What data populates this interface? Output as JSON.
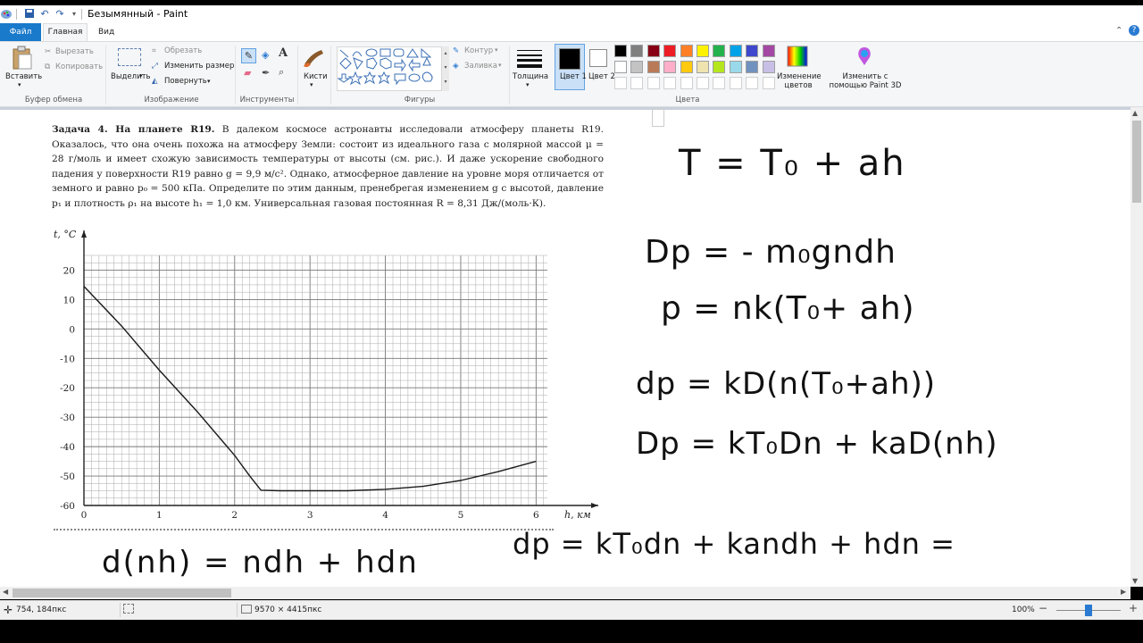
{
  "window": {
    "title": "Безымянный - Paint"
  },
  "tabs": [
    {
      "label": "Файл",
      "active": false,
      "accent": "#1979ca"
    },
    {
      "label": "Главная",
      "active": true
    },
    {
      "label": "Вид",
      "active": false
    }
  ],
  "ribbon": {
    "clipboard": {
      "paste": "Вставить",
      "cut": "Вырезать",
      "copy": "Копировать",
      "group": "Буфер обмена"
    },
    "image": {
      "select": "Выделить",
      "crop": "Обрезать",
      "resize": "Изменить размер",
      "rotate": "Повернуть",
      "group": "Изображение"
    },
    "tools": {
      "group": "Инструменты"
    },
    "brushes": {
      "label": "Кисти"
    },
    "shapes": {
      "outline": "Контур",
      "fill": "Заливка",
      "group": "Фигуры"
    },
    "size": {
      "label": "Толщина"
    },
    "colors": {
      "color1": "Цвет 1",
      "color2": "Цвет 2",
      "edit": "Изменение цветов",
      "paint3d": "Изменить с помощью Paint 3D",
      "group": "Цвета",
      "color1_value": "#000000",
      "color2_value": "#ffffff",
      "palette_row1": [
        "#000000",
        "#7f7f7f",
        "#880015",
        "#ed1c24",
        "#ff7f27",
        "#fff200",
        "#22b14c",
        "#00a2e8",
        "#3f48cc",
        "#a349a4"
      ],
      "palette_row2": [
        "#ffffff",
        "#c3c3c3",
        "#b97a57",
        "#ffaec9",
        "#ffc90e",
        "#efe4b0",
        "#b5e61d",
        "#99d9ea",
        "#7092be",
        "#c8bfe7"
      ]
    }
  },
  "problem": {
    "title": "Задача 4. На планете R19.",
    "body": " В далеком космосе астронавты исследовали атмосферу планеты R19. Оказалось, что она очень похожа на атмосферу Земли: состоит из идеального газа с молярной массой μ = 28 г/моль и имеет схожую зависимость температуры от высоты (см. рис.). И даже ускорение свободного падения у поверхности R19 равно g = 9,9 м/с². Однако, атмосферное давление на уровне моря отличается от земного и равно p₀ = 500 кПа. Определите по этим данным, пренебрегая изменением g с высотой, давление p₁ и плотность ρ₁ на высоте h₁ = 1,0 км. Универсальная газовая постоянная R = 8,31 Дж/(моль·К)."
  },
  "chart_data": {
    "type": "line",
    "xlabel": "h, км",
    "ylabel": "t, °C",
    "xlim": [
      0,
      6.15
    ],
    "ylim": [
      -60,
      25
    ],
    "x_ticks": [
      "0",
      "1",
      "2",
      "3",
      "4",
      "5",
      "6"
    ],
    "y_ticks": [
      "20",
      "10",
      "0",
      "-10",
      "-20",
      "-30",
      "-40",
      "-50",
      "-60"
    ],
    "grid": true,
    "series": [
      {
        "x": [
          0,
          0.5,
          1.0,
          1.5,
          2.0,
          2.2,
          2.35,
          2.6,
          3.0,
          3.5,
          4.0,
          4.5,
          5.0,
          5.5,
          6.0
        ],
        "y": [
          14.5,
          1,
          -14,
          -28,
          -43,
          -50,
          -54.8,
          -55,
          -55,
          -55,
          -54.5,
          -53.5,
          -51.5,
          -48.5,
          -45
        ]
      }
    ]
  },
  "handwriting": [
    "T = T₀ + ah",
    "Dp = - m₀gndh",
    "p = nk(T₀+ ah)",
    "dp = kD(n(T₀+ah))",
    "Dp = kT₀Dn + kaD(nh)",
    "d(nh) = ndh + hdn",
    "dp = kT₀dn + kandh + hdn ="
  ],
  "status": {
    "cursor": "754, 184пкс",
    "size": "9570 × 4415пкс",
    "zoom": "100%",
    "zoom_fraction": 0.5
  }
}
